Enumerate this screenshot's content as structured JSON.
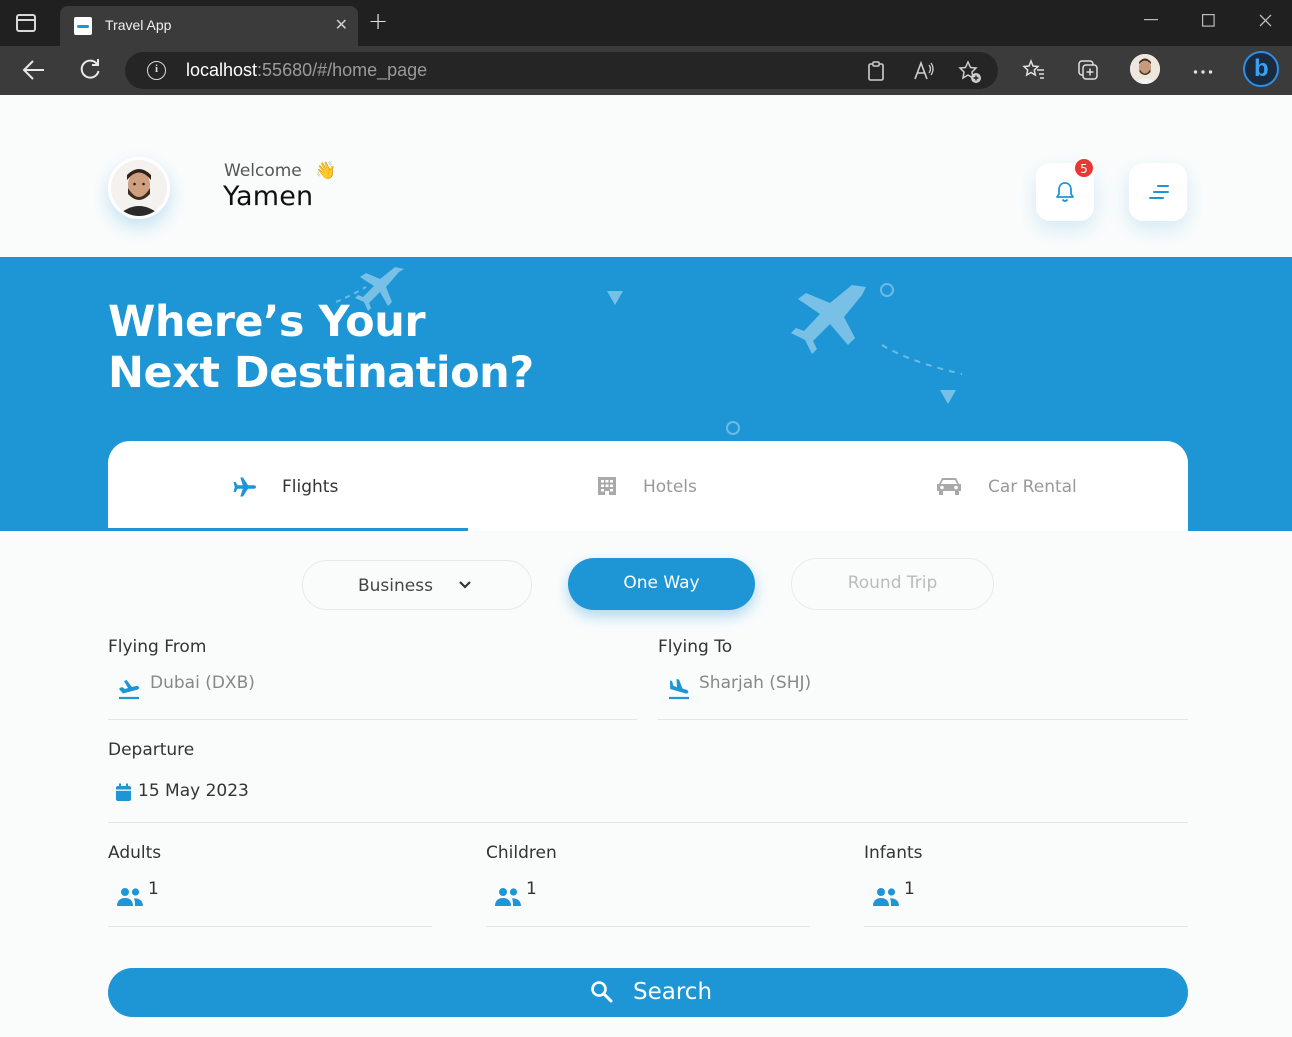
{
  "browser": {
    "tab_title": "Travel App",
    "tab_close": "✕",
    "new_tab": "+",
    "url_host": "localhost",
    "url_rest": ":55680/#/home_page"
  },
  "header": {
    "welcome": "Welcome",
    "wave_emoji": "👋",
    "username": "Yamen",
    "notification_count": "5"
  },
  "hero": {
    "title_line1": "Where’s Your",
    "title_line2": "Next Destination?"
  },
  "tabs": [
    {
      "label": "Flights",
      "icon": "airplane-icon",
      "active": true
    },
    {
      "label": "Hotels",
      "icon": "hotel-icon",
      "active": false
    },
    {
      "label": "Car Rental",
      "icon": "car-icon",
      "active": false
    }
  ],
  "trip_options": {
    "class_selected": "Business",
    "one_way": "One Way",
    "round_trip": "Round Trip"
  },
  "form": {
    "from_label": "Flying From",
    "from_value": "Dubai (DXB)",
    "to_label": "Flying To",
    "to_value": "Sharjah (SHJ)",
    "departure_label": "Departure",
    "departure_value": "15 May 2023",
    "adults_label": "Adults",
    "adults_value": "1",
    "children_label": "Children",
    "children_value": "1",
    "infants_label": "Infants",
    "infants_value": "1"
  },
  "search_label": "Search",
  "colors": {
    "primary": "#1e96d6",
    "badge": "#e53935",
    "background": "#fafcfc"
  }
}
